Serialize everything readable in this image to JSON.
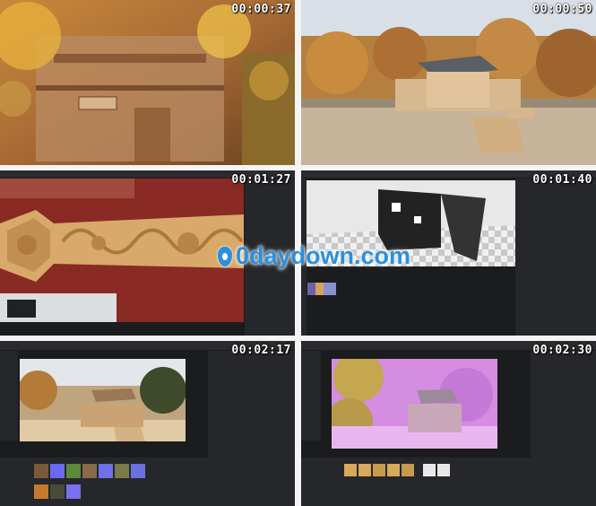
{
  "timestamps": [
    "00:00:37",
    "00:00:50",
    "00:01:27",
    "00:01:40",
    "00:02:17",
    "00:02:30"
  ],
  "watermark": "0daydown.com",
  "colors": {
    "editor_bg": "#1b1c1e",
    "panel": "#26272a",
    "accent": "#2a8fe0"
  }
}
